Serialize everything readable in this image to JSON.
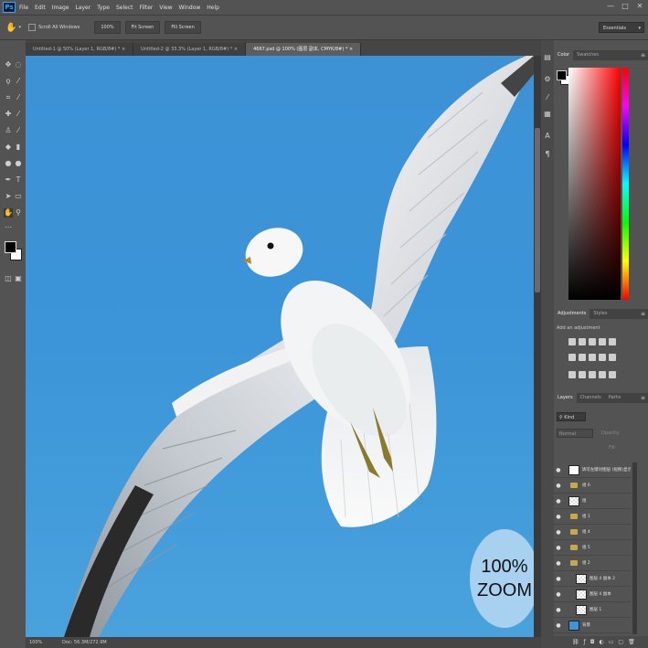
{
  "app": {
    "logo": "Ps"
  },
  "menu": [
    "File",
    "Edit",
    "Image",
    "Layer",
    "Type",
    "Select",
    "Filter",
    "View",
    "Window",
    "Help"
  ],
  "window_controls": {
    "minimize": "—",
    "maximize": "□",
    "close": "✕"
  },
  "options": {
    "scroll_all_windows_label": "Scroll All Windows",
    "zoom_100_label": "100%",
    "fit_screen_label": "Fit Screen",
    "fill_screen_label": "Fill Screen",
    "workspace": "Essentials"
  },
  "tabs": [
    {
      "label": "Untitled-1 @ 50% (Layer 1, RGB/8#) *",
      "close": "×"
    },
    {
      "label": "Untitled-2 @ 33.3% (Layer 1, RGB/8#) *",
      "close": "×"
    },
    {
      "label": "4667.psd @ 100% (图层 副本, CMYK/8#) *",
      "close": "×"
    }
  ],
  "status": {
    "zoom": "100%",
    "doc": "Doc: 56.3M/272.9M"
  },
  "zoom_badge": {
    "line1": "100%",
    "line2": "ZOOM"
  },
  "color_panel": {
    "tabs": [
      "Color",
      "Swatches"
    ],
    "menu": "≡"
  },
  "adjustments_panel": {
    "tabs": [
      "Adjustments",
      "Styles"
    ],
    "hint": "Add an adjustment"
  },
  "layers_panel": {
    "tabs": [
      "Layers",
      "Channels",
      "Paths"
    ],
    "filter_kind": "Kind",
    "blend_mode": "Normal",
    "opacity_label": "Opacity:",
    "fill_label": "Fill:",
    "layers": [
      {
        "name": "请可左键对图层 (视频)显示",
        "type": "layer",
        "visible": "●"
      },
      {
        "name": "组 6",
        "type": "group",
        "visible": "●"
      },
      {
        "name": "组",
        "type": "layer",
        "visible": "●"
      },
      {
        "name": "组 1",
        "type": "group",
        "visible": "●"
      },
      {
        "name": "组 4",
        "type": "group",
        "visible": "●"
      },
      {
        "name": "组 5",
        "type": "group",
        "visible": "●"
      },
      {
        "name": "组 2",
        "type": "group",
        "visible": "●"
      },
      {
        "name": "图层 4 副本 2",
        "type": "layer",
        "visible": "●"
      },
      {
        "name": "图层 4 副本",
        "type": "layer",
        "visible": "●"
      },
      {
        "name": "图层 1",
        "type": "layer",
        "visible": "●"
      },
      {
        "name": "背景",
        "type": "layer",
        "visible": "●"
      }
    ]
  },
  "colors": {
    "foreground": "#000000",
    "background": "#ffffff",
    "sky": "#3b95d8",
    "badge": "#a8d0ef"
  }
}
